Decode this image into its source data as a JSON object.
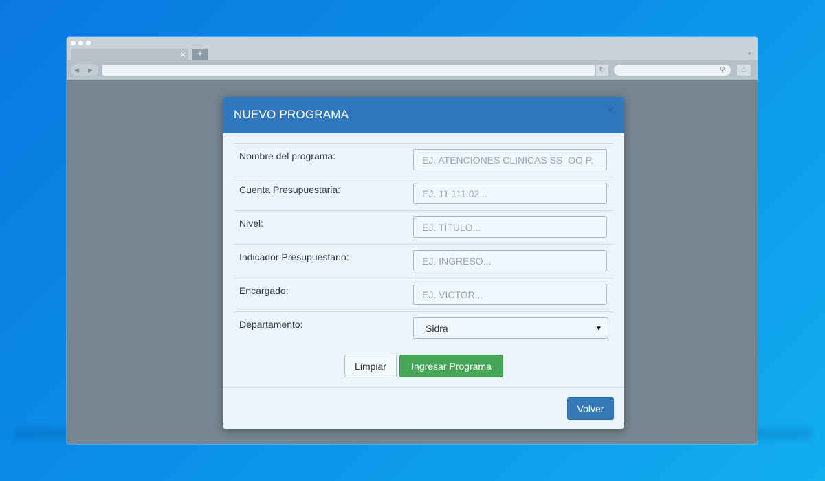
{
  "browser": {
    "tab_close": "×",
    "new_tab": "+",
    "icons": {
      "back": "back-arrow-icon",
      "forward": "forward-arrow-icon",
      "reload": "reload-icon",
      "search": "search-icon",
      "home": "home-icon",
      "tab_menu": "chevron-down-icon"
    }
  },
  "modal": {
    "title": "NUEVO PROGRAMA",
    "close": "×",
    "fields": [
      {
        "label": "Nombre del programa:",
        "placeholder": "EJ. ATENCIONES CLINICAS SS  OO P."
      },
      {
        "label": "Cuenta Presupuestaria:",
        "placeholder": "EJ. 11.111.02..."
      },
      {
        "label": "Nivel:",
        "placeholder": "EJ. TÍTULO..."
      },
      {
        "label": "Indicador Presupuestario:",
        "placeholder": "EJ. INGRESO..."
      },
      {
        "label": "Encargado:",
        "placeholder": "EJ. VICTOR..."
      }
    ],
    "department": {
      "label": "Departamento:",
      "selected": "Sidra"
    },
    "buttons": {
      "clear": "Limpiar",
      "submit": "Ingresar Programa",
      "back": "Volver"
    }
  },
  "colors": {
    "background": "#0a8ee8",
    "modal_header": "#3077bf",
    "submit_button": "#46a557",
    "back_button": "#347ab9",
    "viewport": "#77858f"
  }
}
